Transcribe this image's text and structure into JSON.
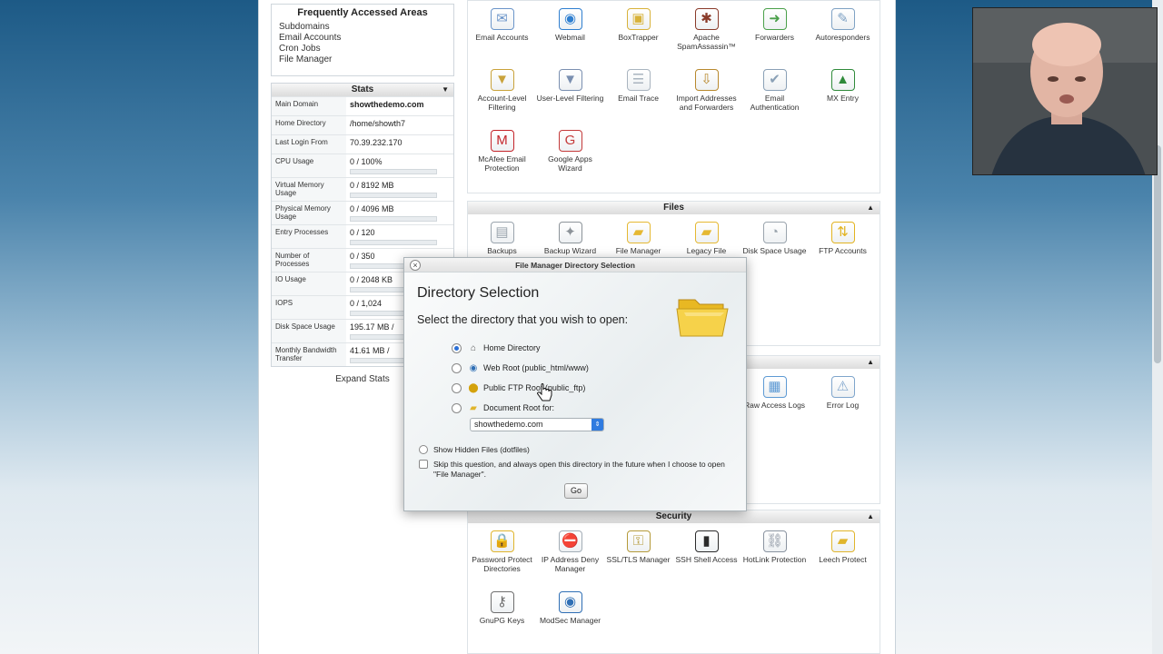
{
  "faa": {
    "title": "Frequently Accessed Areas",
    "links": [
      "Subdomains",
      "Email Accounts",
      "Cron Jobs",
      "File Manager"
    ]
  },
  "stats": {
    "title": "Stats",
    "rows": [
      {
        "k": "Main Domain",
        "v": "showthedemo.com",
        "bold": true
      },
      {
        "k": "Home Directory",
        "v": "/home/showth7"
      },
      {
        "k": "Last Login From",
        "v": "70.39.232.170"
      },
      {
        "k": "CPU Usage",
        "v": "0 / 100%",
        "bar": true
      },
      {
        "k": "Virtual Memory Usage",
        "v": "0 / 8192 MB",
        "bar": true
      },
      {
        "k": "Physical Memory Usage",
        "v": "0 / 4096 MB",
        "bar": true
      },
      {
        "k": "Entry Processes",
        "v": "0 / 120",
        "bar": true
      },
      {
        "k": "Number of Processes",
        "v": "0 / 350",
        "bar": true
      },
      {
        "k": "IO Usage",
        "v": "0 / 2048 KB",
        "bar": true
      },
      {
        "k": "IOPS",
        "v": "0 / 1,024",
        "bar": true
      },
      {
        "k": "Disk Space Usage",
        "v": "195.17 MB /",
        "bar": true
      },
      {
        "k": "Monthly Bandwidth Transfer",
        "v": "41.61 MB /",
        "bar": true
      }
    ],
    "expand": "Expand Stats"
  },
  "mail": {
    "icons": [
      {
        "label": "Email Accounts",
        "icon": "envelope-icon",
        "color": "#6b95c9",
        "glyph": "✉"
      },
      {
        "label": "Webmail",
        "icon": "globe-icon",
        "color": "#2f7fd0",
        "glyph": "◉"
      },
      {
        "label": "BoxTrapper",
        "icon": "box-icon",
        "color": "#d8b23a",
        "glyph": "▣"
      },
      {
        "label": "Apache SpamAssassin™",
        "icon": "spam-icon",
        "color": "#8a3b2a",
        "glyph": "✱"
      },
      {
        "label": "Forwarders",
        "icon": "forward-icon",
        "color": "#4aa04a",
        "glyph": "➜"
      },
      {
        "label": "Autoresponders",
        "icon": "autorespond-icon",
        "color": "#7fa2c4",
        "glyph": "✎"
      },
      {
        "label": "Account-Level Filtering",
        "icon": "filter-icon",
        "color": "#c9a23a",
        "glyph": "▼"
      },
      {
        "label": "User-Level Filtering",
        "icon": "user-filter-icon",
        "color": "#7a8fb0",
        "glyph": "▼"
      },
      {
        "label": "Email Trace",
        "icon": "trace-icon",
        "color": "#a9b4bf",
        "glyph": "☰"
      },
      {
        "label": "Import Addresses and Forwarders",
        "icon": "import-icon",
        "color": "#b8892e",
        "glyph": "⇩"
      },
      {
        "label": "Email Authentication",
        "icon": "auth-icon",
        "color": "#8aa0b6",
        "glyph": "✔"
      },
      {
        "label": "MX Entry",
        "icon": "mx-icon",
        "color": "#2f8a3a",
        "glyph": "▲"
      },
      {
        "label": "McAfee Email Protection",
        "icon": "shield-icon",
        "color": "#c4242a",
        "glyph": "M"
      },
      {
        "label": "Google Apps Wizard",
        "icon": "google-icon",
        "color": "#c43a3a",
        "glyph": "G"
      }
    ]
  },
  "files": {
    "title": "Files",
    "icons": [
      {
        "label": "Backups",
        "icon": "backup-icon",
        "color": "#9aa4ad",
        "glyph": "▤"
      },
      {
        "label": "Backup Wizard",
        "icon": "wizard-icon",
        "color": "#8c9399",
        "glyph": "✦"
      },
      {
        "label": "File Manager",
        "icon": "folder-icon",
        "color": "#e5b832",
        "glyph": "▰"
      },
      {
        "label": "Legacy File Manager",
        "icon": "folder-icon",
        "color": "#e5b832",
        "glyph": "▰"
      },
      {
        "label": "Disk Space Usage",
        "icon": "disk-icon",
        "color": "#9aa4ad",
        "glyph": "◔"
      },
      {
        "label": "FTP Accounts",
        "icon": "ftp-icon",
        "color": "#e2b320",
        "glyph": "⇅"
      }
    ]
  },
  "logs": {
    "icons": [
      {
        "label": "Raw Access Logs",
        "icon": "raw-log-icon",
        "color": "#5e9ad4",
        "glyph": "▦"
      },
      {
        "label": "Error Log",
        "icon": "error-log-icon",
        "color": "#7fa5cc",
        "glyph": "⚠"
      }
    ]
  },
  "security": {
    "title": "Security",
    "icons": [
      {
        "label": "Password Protect Directories",
        "icon": "lock-folder-icon",
        "color": "#e0b52c",
        "glyph": "🔒"
      },
      {
        "label": "IP Address Deny Manager",
        "icon": "ip-deny-icon",
        "color": "#a3adb6",
        "glyph": "⛔"
      },
      {
        "label": "SSL/TLS Manager",
        "icon": "ssl-icon",
        "color": "#b59a3a",
        "glyph": "⚿"
      },
      {
        "label": "SSH Shell Access",
        "icon": "terminal-icon",
        "color": "#2b2b2b",
        "glyph": "▮"
      },
      {
        "label": "HotLink Protection",
        "icon": "hotlink-icon",
        "color": "#8a93a0",
        "glyph": "⛓"
      },
      {
        "label": "Leech Protect",
        "icon": "leech-icon",
        "color": "#e0b52c",
        "glyph": "▰"
      },
      {
        "label": "GnuPG Keys",
        "icon": "key-icon",
        "color": "#6e6e6e",
        "glyph": "⚷"
      },
      {
        "label": "ModSec Manager",
        "icon": "modsec-icon",
        "color": "#2f6fb5",
        "glyph": "◉"
      }
    ]
  },
  "dialog": {
    "title": "File Manager Directory Selection",
    "heading": "Directory Selection",
    "prompt": "Select the directory that you wish to open:",
    "options": [
      "Home Directory",
      "Web Root (public_html/www)",
      "Public FTP Root (public_ftp)",
      "Document Root for:"
    ],
    "selected": 0,
    "domain_select": "showthedemo.com",
    "show_hidden": "Show Hidden Files (dotfiles)",
    "skip": "Skip this question, and always open this directory in the future when I choose to open \"File Manager\".",
    "go": "Go"
  }
}
